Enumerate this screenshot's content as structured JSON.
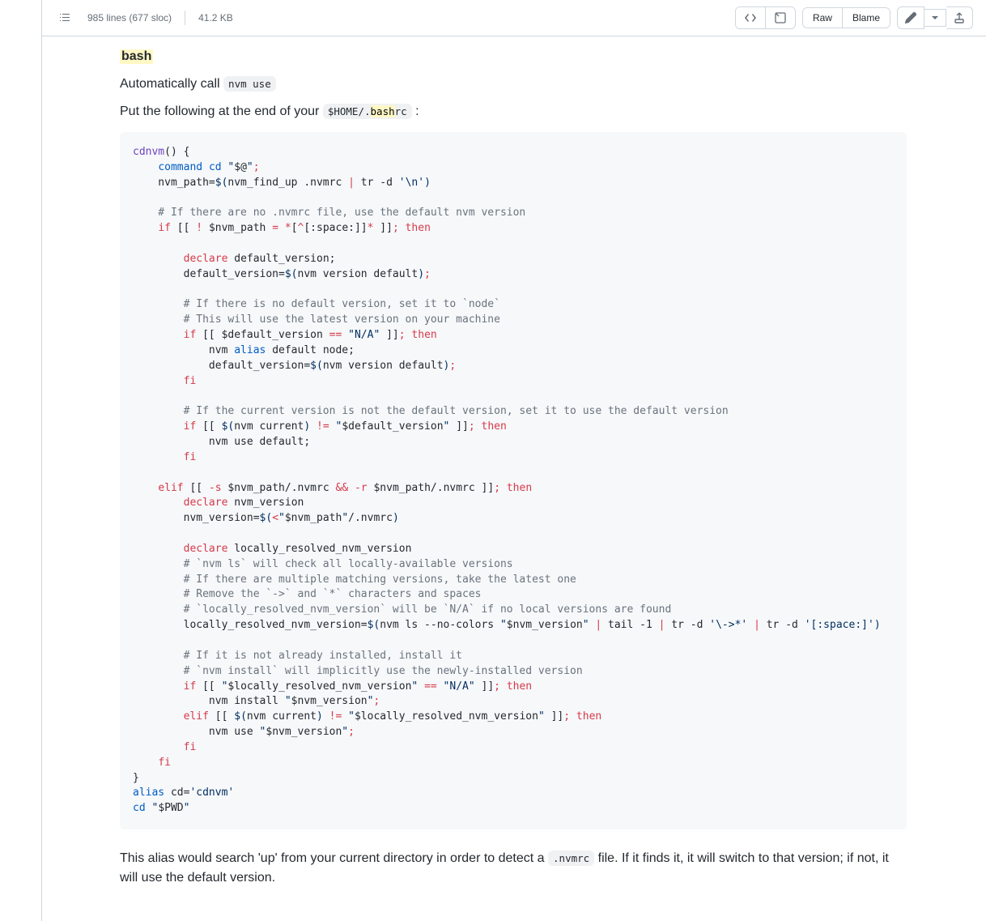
{
  "fileHeader": {
    "lines": "985 lines (677 sloc)",
    "size": "41.2 KB",
    "rawLabel": "Raw",
    "blameLabel": "Blame"
  },
  "section": {
    "heading": "bash",
    "autoPrefix": "Automatically call ",
    "nvmUse": "nvm use",
    "putPrefix": "Put the following at the end of your ",
    "homePrefix": "$HOME/.",
    "bashHighlight": "bash",
    "rcSuffix": "rc",
    "putSuffix": " :",
    "afterPrefix": "This alias would search 'up' from your current directory in order to detect a ",
    "nvmrcInline": ".nvmrc",
    "afterSuffix": " file. If it finds it, it will switch to that version; if not, it will use the default version."
  },
  "code": {
    "t1a": "cdnvm",
    "t1b": "()",
    "t1c": " {",
    "t2a": "    ",
    "t2b": "command",
    "t2c": " ",
    "t2d": "cd",
    "t2e": " ",
    "t2f": "\"",
    "t2g": "$@",
    "t2h": "\"",
    "t2i": ";",
    "t3a": "    nvm_path=",
    "t3b": "$(",
    "t3c": "nvm_find_up .nvmrc ",
    "t3d": "|",
    "t3e": " tr -d ",
    "t3f": "'",
    "t3g": "\\n",
    "t3h": "'",
    "t3i": ")",
    "t4": "    # If there are no .nvmrc file, use the default nvm version",
    "t5a": "    ",
    "t5b": "if",
    "t5c": " [[ ",
    "t5d": "!",
    "t5e": " ",
    "t5f": "$nvm_path",
    "t5g": " ",
    "t5h": "=",
    "t5i": " ",
    "t5j": "*",
    "t5k": "[",
    "t5l": "^",
    "t5m": "[:space:]]",
    "t5n": "*",
    "t5o": " ]]",
    "t5p": ";",
    "t5q": " ",
    "t5r": "then",
    "t6a": "        ",
    "t6b": "declare",
    "t6c": " default_version;",
    "t7a": "        default_version=",
    "t7b": "$(",
    "t7c": "nvm version default",
    "t7d": ")",
    "t7e": ";",
    "t8": "        # If there is no default version, set it to `node`",
    "t9": "        # This will use the latest version on your machine",
    "t10a": "        ",
    "t10b": "if",
    "t10c": " [[ ",
    "t10d": "$default_version",
    "t10e": " ",
    "t10f": "==",
    "t10g": " ",
    "t10h": "\"",
    "t10i": "N/A",
    "t10j": "\"",
    "t10k": " ]]",
    "t10l": ";",
    "t10m": " ",
    "t10n": "then",
    "t11a": "            nvm ",
    "t11b": "alias",
    "t11c": " default node;",
    "t12a": "            default_version=",
    "t12b": "$(",
    "t12c": "nvm version default",
    "t12d": ")",
    "t12e": ";",
    "t13a": "        ",
    "t13b": "fi",
    "t14": "        # If the current version is not the default version, set it to use the default version",
    "t15a": "        ",
    "t15b": "if",
    "t15c": " [[ ",
    "t15d": "$(",
    "t15e": "nvm current",
    "t15f": ")",
    "t15g": " ",
    "t15h": "!=",
    "t15i": " ",
    "t15j": "\"",
    "t15k": "$default_version",
    "t15l": "\"",
    "t15m": " ]]",
    "t15n": ";",
    "t15o": " ",
    "t15p": "then",
    "t16": "            nvm use default;",
    "t17a": "        ",
    "t17b": "fi",
    "t18a": "    ",
    "t18b": "elif",
    "t18c": " [[ ",
    "t18d": "-s",
    "t18e": " ",
    "t18f": "$nvm_path",
    "t18g": "/.nvmrc ",
    "t18h": "&&",
    "t18i": " ",
    "t18j": "-r",
    "t18k": " ",
    "t18l": "$nvm_path",
    "t18m": "/.nvmrc ]]",
    "t18n": ";",
    "t18o": " ",
    "t18p": "then",
    "t19a": "        ",
    "t19b": "declare",
    "t19c": " nvm_version",
    "t20a": "        nvm_version=",
    "t20b": "$(",
    "t20c": "<",
    "t20d": "\"",
    "t20e": "$nvm_path",
    "t20f": "\"",
    "t20g": "/.nvmrc",
    "t20h": ")",
    "t21a": "        ",
    "t21b": "declare",
    "t21c": " locally_resolved_nvm_version",
    "t22": "        # `nvm ls` will check all locally-available versions",
    "t23": "        # If there are multiple matching versions, take the latest one",
    "t24": "        # Remove the `->` and `*` characters and spaces",
    "t25": "        # `locally_resolved_nvm_version` will be `N/A` if no local versions are found",
    "t26a": "        locally_resolved_nvm_version=",
    "t26b": "$(",
    "t26c": "nvm ls --no-colors ",
    "t26d": "\"",
    "t26e": "$nvm_version",
    "t26f": "\"",
    "t26g": " ",
    "t26h": "|",
    "t26i": " tail -1 ",
    "t26j": "|",
    "t26k": " tr -d ",
    "t26l": "'",
    "t26m": "\\->*",
    "t26n": "'",
    "t26o": " ",
    "t26p": "|",
    "t26q": " tr -d ",
    "t26r": "'",
    "t26s": "[:space:]",
    "t26t": "'",
    "t26u": ")",
    "t27": "        # If it is not already installed, install it",
    "t28": "        # `nvm install` will implicitly use the newly-installed version",
    "t29a": "        ",
    "t29b": "if",
    "t29c": " [[ ",
    "t29d": "\"",
    "t29e": "$locally_resolved_nvm_version",
    "t29f": "\"",
    "t29g": " ",
    "t29h": "==",
    "t29i": " ",
    "t29j": "\"",
    "t29k": "N/A",
    "t29l": "\"",
    "t29m": " ]]",
    "t29n": ";",
    "t29o": " ",
    "t29p": "then",
    "t30a": "            nvm install ",
    "t30b": "\"",
    "t30c": "$nvm_version",
    "t30d": "\"",
    "t30e": ";",
    "t31a": "        ",
    "t31b": "elif",
    "t31c": " [[ ",
    "t31d": "$(",
    "t31e": "nvm current",
    "t31f": ")",
    "t31g": " ",
    "t31h": "!=",
    "t31i": " ",
    "t31j": "\"",
    "t31k": "$locally_resolved_nvm_version",
    "t31l": "\"",
    "t31m": " ]]",
    "t31n": ";",
    "t31o": " ",
    "t31p": "then",
    "t32a": "            nvm use ",
    "t32b": "\"",
    "t32c": "$nvm_version",
    "t32d": "\"",
    "t32e": ";",
    "t33a": "        ",
    "t33b": "fi",
    "t34a": "    ",
    "t34b": "fi",
    "t35": "}",
    "t36a": "alias",
    "t36b": " cd=",
    "t36c": "'",
    "t36d": "cdnvm",
    "t36e": "'",
    "t37a": "cd",
    "t37b": " ",
    "t37c": "\"",
    "t37d": "$PWD",
    "t37e": "\""
  }
}
